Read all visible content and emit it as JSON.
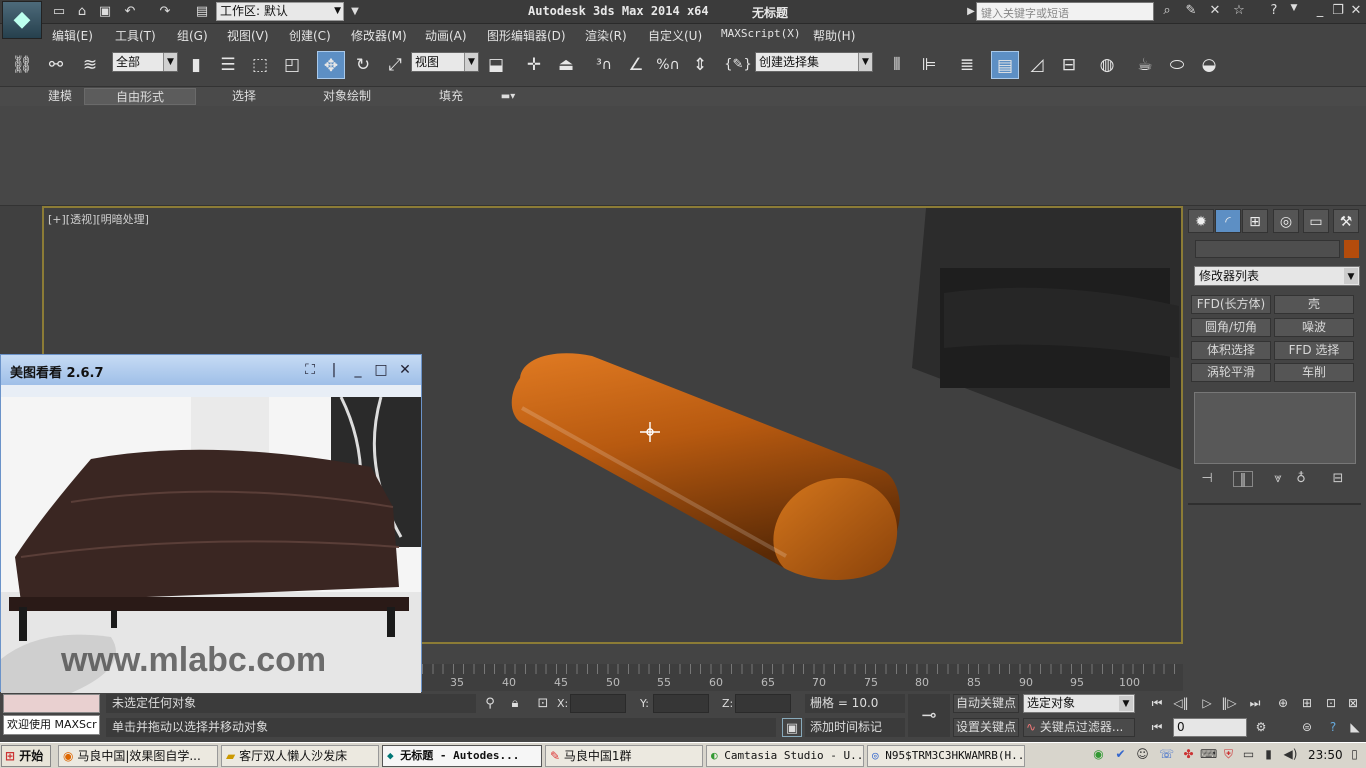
{
  "titlebar": {
    "app_title": "Autodesk 3ds Max  2014 x64",
    "doc_title": "无标题",
    "workspace_label": "工作区: 默认",
    "search_placeholder": "键入关键字或短语"
  },
  "menus": [
    "编辑(E)",
    "工具(T)",
    "组(G)",
    "视图(V)",
    "创建(C)",
    "修改器(M)",
    "动画(A)",
    "图形编辑器(D)",
    "渲染(R)",
    "自定义(U)",
    "MAXScript(X)",
    "帮助(H)"
  ],
  "toolbar": {
    "filter_value": "全部",
    "refcoord_value": "视图",
    "selset_value": "创建选择集"
  },
  "ribbon_tabs": [
    "建模",
    "自由形式",
    "选择",
    "对象绘制",
    "填充"
  ],
  "viewport": {
    "label": "[+][透视][明暗处理]"
  },
  "command_panel": {
    "modifier_list": "修改器列表",
    "buttons": [
      "FFD(长方体)",
      "壳",
      "圆角/切角",
      "噪波",
      "体积选择",
      "FFD 选择",
      "涡轮平滑",
      "车削"
    ]
  },
  "timeline": {
    "ticks": [
      "35",
      "40",
      "45",
      "50",
      "55",
      "60",
      "65",
      "70",
      "75",
      "80",
      "85",
      "90",
      "95",
      "100"
    ]
  },
  "status": {
    "welcome": "欢迎使用 MAXScr",
    "line1": "未选定任何对象",
    "line2": "单击并拖动以选择并移动对象",
    "x_label": "X:",
    "y_label": "Y:",
    "z_label": "Z:",
    "grid": "栅格 = 10.0",
    "add_time_tag": "添加时间标记",
    "auto_key": "自动关键点",
    "set_key": "设置关键点",
    "selected_object": "选定对象",
    "key_filters": "关键点过滤器...",
    "frame": "0"
  },
  "meitu": {
    "title": "美图看看 2.6.7",
    "watermark_text": "www.mlabc.com"
  },
  "taskbar": {
    "start": "开始",
    "tasks": [
      "马良中国|效果图自学...",
      "客厅双人懒人沙发床",
      "无标题 - Autodes...",
      "马良中国1群",
      "Camtasia Studio - U...",
      "N95$TRM3C3HKWAMRB(H..."
    ],
    "clock": "23:50"
  },
  "colors": {
    "viewport_border": "#8c7c36",
    "object_orange": "#b85a10",
    "selection_blue": "#5d8fc4",
    "swatch": "#b44c0c"
  }
}
